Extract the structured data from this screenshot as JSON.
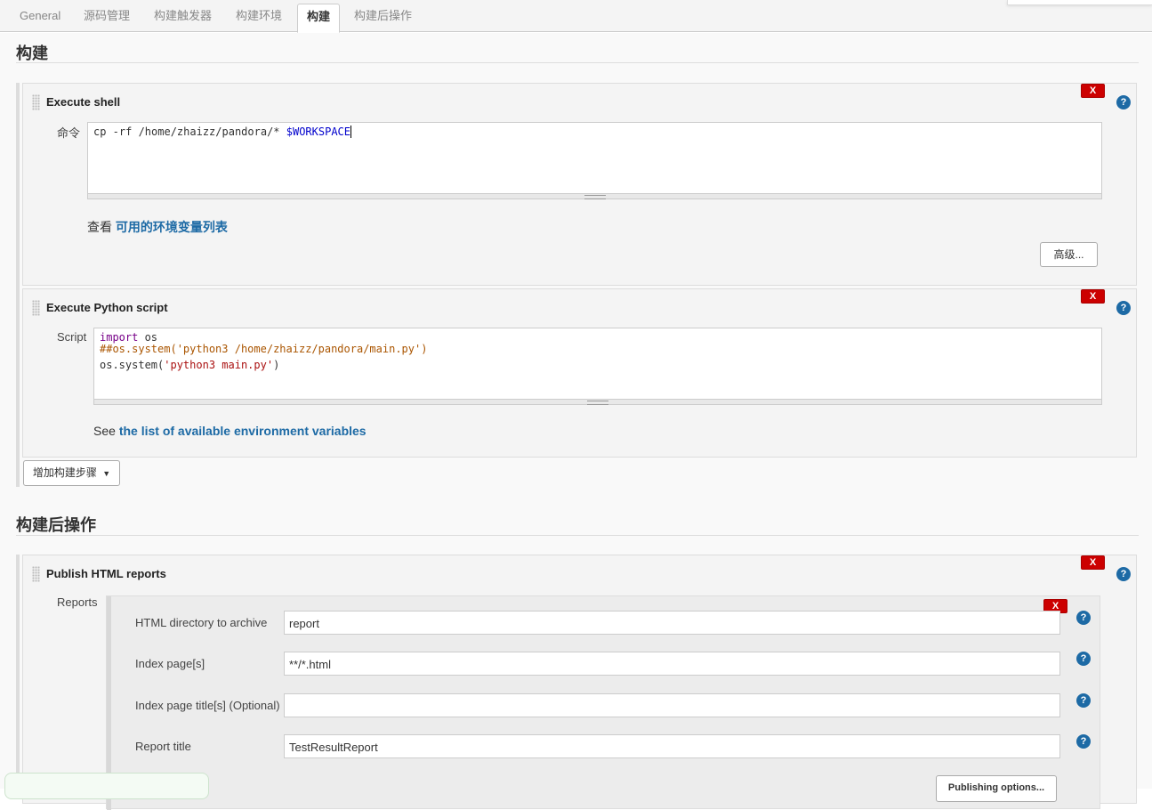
{
  "tabs": [
    {
      "label": "General",
      "active": false
    },
    {
      "label": "源码管理",
      "active": false
    },
    {
      "label": "构建触发器",
      "active": false
    },
    {
      "label": "构建环境",
      "active": false
    },
    {
      "label": "构建",
      "active": true
    },
    {
      "label": "构建后操作",
      "active": false
    }
  ],
  "build": {
    "section_title": "构建",
    "shell_step": {
      "title": "Execute shell",
      "delete_label": "X",
      "help_label": "?",
      "command_label": "命令",
      "command_parts": {
        "plain": "cp -rf /home/zhaizz/pandora/* ",
        "var": "$WORKSPACE"
      },
      "env_prefix": "查看 ",
      "env_link": "可用的环境变量列表",
      "advanced_button": "高级..."
    },
    "python_step": {
      "title": "Execute Python script",
      "delete_label": "X",
      "help_label": "?",
      "script_label": "Script",
      "line1_kw": "import",
      "line1_rest": " os",
      "line2": "##os.system('python3 /home/zhaizz/pandora/main.py')",
      "line3_fn": "os.system(",
      "line3_str": "'python3 main.py'",
      "line3_end": ")",
      "env_prefix": "See ",
      "env_link": "the list of available environment variables"
    },
    "add_step_button": "增加构建步骤"
  },
  "post_build": {
    "section_title": "构建后操作",
    "publish_step": {
      "title": "Publish HTML reports",
      "delete_label": "X",
      "help_label": "?",
      "reports_label": "Reports",
      "report_delete_label": "X",
      "fields": [
        {
          "label": "HTML directory to archive",
          "value": "report"
        },
        {
          "label": "Index page[s]",
          "value": "**/*.html"
        },
        {
          "label": "Index page title[s] (Optional)",
          "value": ""
        },
        {
          "label": "Report title",
          "value": "TestResultReport"
        }
      ],
      "publishing_options_button": "Publishing options..."
    }
  },
  "colors": {
    "delete": "#cc0000",
    "help": "#1d6aa5",
    "link": "#1d6aa5"
  }
}
